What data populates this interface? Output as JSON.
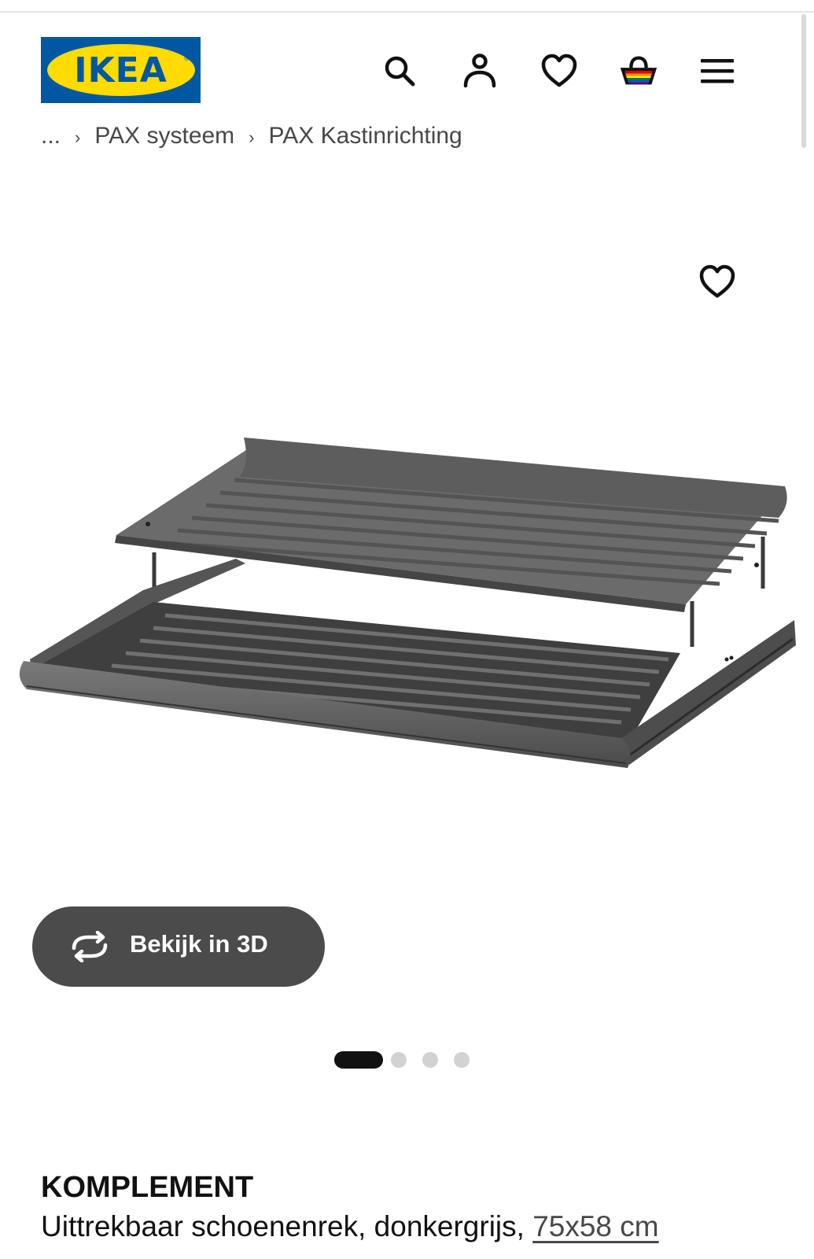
{
  "header": {
    "logo_text": "IKEA",
    "logo_registered": "®",
    "colors": {
      "logo_blue": "#0058a3",
      "logo_yellow": "#ffdb00"
    },
    "icons": [
      "search-icon",
      "account-icon",
      "wishlist-heart-icon",
      "shopping-bag-icon",
      "menu-icon"
    ]
  },
  "breadcrumb": {
    "ellipsis": "...",
    "separator": "›",
    "items": [
      "PAX systeem",
      "PAX Kastinrichting"
    ]
  },
  "product": {
    "image_alt": "KOMPLEMENT uittrekbaar schoenenrek, donkergrijs",
    "favourite_icon": "heart-outline-icon",
    "view_3d_label": "Bekijk in 3D",
    "carousel": {
      "total": 4,
      "active_index": 0
    },
    "name": "KOMPLEMENT",
    "description": "Uittrekbaar schoenenrek, donkergrijs,",
    "size": "75x58 cm"
  }
}
